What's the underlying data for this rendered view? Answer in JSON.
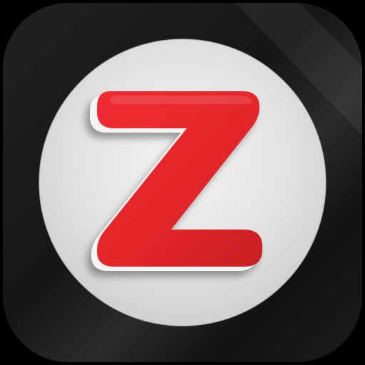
{
  "app_icon": {
    "icon_name": "zoho-z-app-icon",
    "letter": "Z",
    "colors": {
      "tile": "#151515",
      "tile_sheen": "#2a2a2a",
      "disc": "#dcdcdc",
      "disc_highlight": "#f4f4f4",
      "letter": "#e3262a",
      "letter_shade": "#b81c20",
      "letter_outline": "#f7f7f7"
    }
  }
}
